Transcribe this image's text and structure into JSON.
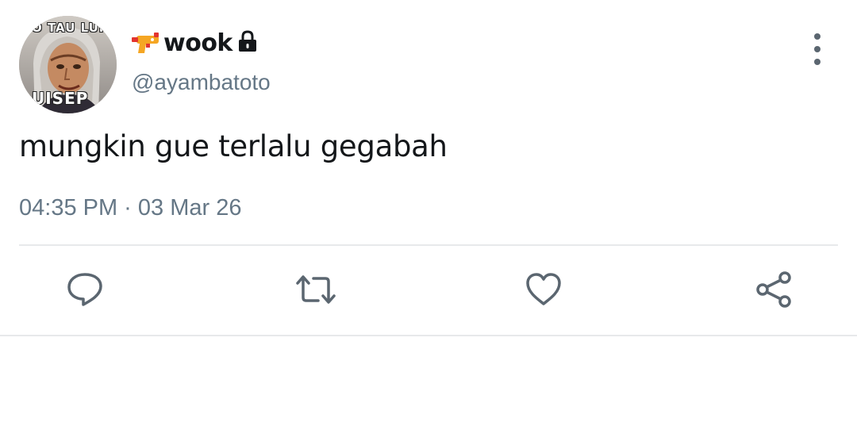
{
  "tweet": {
    "avatar": {
      "top_text": "O TAU LUIS",
      "bottom_text": "UISEP"
    },
    "display_name": "wook",
    "name_prefix_icon": "water-gun-icon",
    "protected_icon": "lock-icon",
    "handle": "@ayambatoto",
    "text": "mungkin gue terlalu gegabah",
    "timestamp": "04:35 PM · 03 Mar 26"
  },
  "actions": [
    {
      "name": "reply",
      "icon": "reply-icon"
    },
    {
      "name": "retweet",
      "icon": "retweet-icon"
    },
    {
      "name": "like",
      "icon": "heart-icon"
    },
    {
      "name": "share",
      "icon": "share-icon"
    }
  ],
  "colors": {
    "text_primary": "#14171a",
    "text_secondary": "#657786",
    "icon_gray": "#5b6670",
    "divider": "#e7e9eb",
    "gun_orange": "#f5a623",
    "gun_red": "#e3342f"
  }
}
